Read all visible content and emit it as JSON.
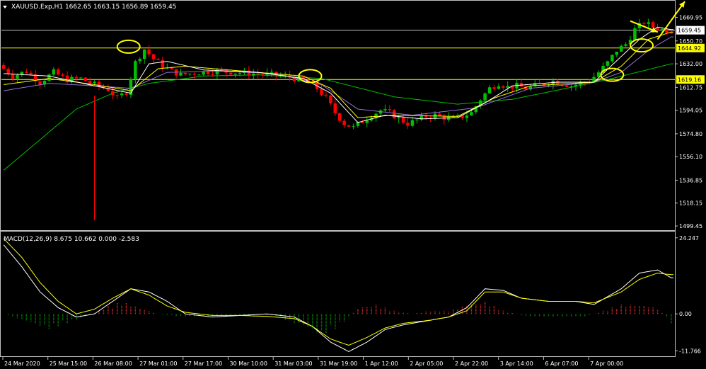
{
  "chart_data": {
    "type": "candlestick",
    "symbol": "XAUUSD.Exp",
    "timeframe": "H1",
    "ohlc_label": {
      "open": "1662.65",
      "high": "1663.15",
      "low": "1656.89",
      "close": "1659.45"
    },
    "header_text": "XAUUSD.Exp,H1  1662.65 1663.15 1656.89 1659.45",
    "price_axis": {
      "ylim": [
        1496,
        1683
      ],
      "ticks": [
        "1669.95",
        "1650.70",
        "1632.00",
        "1612.75",
        "1594.05",
        "1574.80",
        "1556.10",
        "1536.85",
        "1518.15",
        "1499.45"
      ],
      "tick_values": [
        1669.95,
        1650.7,
        1632.0,
        1612.75,
        1594.05,
        1574.8,
        1556.1,
        1536.85,
        1518.15,
        1499.45
      ]
    },
    "price_labels": [
      {
        "text": "1659.45",
        "value": 1659.45,
        "bg": "#ffffff",
        "fg": "#000000"
      },
      {
        "text": "1644.92",
        "value": 1644.92,
        "bg": "#ffff00",
        "fg": "#000000"
      },
      {
        "text": "1619.16",
        "value": 1619.16,
        "bg": "#ffff00",
        "fg": "#000000"
      }
    ],
    "horizontal_lines": [
      {
        "value": 1659.45,
        "color": "#c0c0c0"
      },
      {
        "value": 1644.92,
        "color": "#ffff00"
      },
      {
        "value": 1619.16,
        "color": "#ffff00"
      }
    ],
    "time_axis": {
      "labels": [
        "24 Mar 2020",
        "25 Mar 15:00",
        "26 Mar 08:00",
        "27 Mar 01:00",
        "27 Mar 17:00",
        "30 Mar 10:00",
        "31 Mar 03:00",
        "31 Mar 19:00",
        "1 Apr 12:00",
        "2 Apr 05:00",
        "2 Apr 22:00",
        "3 Apr 14:00",
        "6 Apr 07:00",
        "7 Apr 00:00"
      ]
    },
    "price_path": [
      [
        0,
        1631
      ],
      [
        3,
        1622
      ],
      [
        6,
        1626
      ],
      [
        9,
        1617
      ],
      [
        12,
        1625
      ],
      [
        15,
        1619
      ],
      [
        18,
        1620
      ],
      [
        21,
        1615
      ],
      [
        24,
        1611
      ],
      [
        26,
        1604
      ],
      [
        28,
        1609
      ],
      [
        30,
        1633
      ],
      [
        32,
        1644
      ],
      [
        34,
        1636
      ],
      [
        36,
        1630
      ],
      [
        38,
        1626
      ],
      [
        40,
        1623
      ],
      [
        44,
        1625
      ],
      [
        48,
        1626
      ],
      [
        52,
        1625
      ],
      [
        56,
        1624
      ],
      [
        60,
        1623
      ],
      [
        64,
        1621
      ],
      [
        66,
        1619
      ],
      [
        68,
        1617
      ],
      [
        70,
        1612
      ],
      [
        72,
        1604
      ],
      [
        74,
        1592
      ],
      [
        76,
        1583
      ],
      [
        78,
        1580
      ],
      [
        80,
        1585
      ],
      [
        82,
        1590
      ],
      [
        84,
        1594
      ],
      [
        86,
        1592
      ],
      [
        88,
        1587
      ],
      [
        90,
        1583
      ],
      [
        92,
        1586
      ],
      [
        94,
        1589
      ],
      [
        96,
        1590
      ],
      [
        98,
        1588
      ],
      [
        100,
        1587
      ],
      [
        102,
        1589
      ],
      [
        104,
        1592
      ],
      [
        106,
        1603
      ],
      [
        108,
        1612
      ],
      [
        110,
        1616
      ],
      [
        112,
        1613
      ],
      [
        114,
        1614
      ],
      [
        116,
        1612
      ],
      [
        118,
        1614
      ],
      [
        120,
        1616
      ],
      [
        122,
        1618
      ],
      [
        124,
        1616
      ],
      [
        126,
        1614
      ],
      [
        128,
        1616
      ],
      [
        130,
        1618
      ],
      [
        132,
        1625
      ],
      [
        134,
        1633
      ],
      [
        136,
        1643
      ],
      [
        138,
        1648
      ],
      [
        140,
        1660
      ],
      [
        142,
        1666
      ],
      [
        144,
        1662
      ],
      [
        146,
        1660
      ],
      [
        147,
        1659.45
      ]
    ],
    "ma_fast": [
      [
        0,
        1624
      ],
      [
        10,
        1622
      ],
      [
        20,
        1614
      ],
      [
        28,
        1608
      ],
      [
        32,
        1632
      ],
      [
        36,
        1634
      ],
      [
        44,
        1627
      ],
      [
        56,
        1625
      ],
      [
        66,
        1620
      ],
      [
        72,
        1608
      ],
      [
        78,
        1584
      ],
      [
        84,
        1590
      ],
      [
        92,
        1587
      ],
      [
        100,
        1588
      ],
      [
        106,
        1600
      ],
      [
        112,
        1614
      ],
      [
        122,
        1617
      ],
      [
        130,
        1617
      ],
      [
        136,
        1638
      ],
      [
        140,
        1652
      ],
      [
        144,
        1662
      ],
      [
        147,
        1660
      ]
    ],
    "ma_mid": [
      [
        0,
        1615
      ],
      [
        10,
        1620
      ],
      [
        20,
        1615
      ],
      [
        28,
        1610
      ],
      [
        34,
        1628
      ],
      [
        40,
        1630
      ],
      [
        56,
        1625
      ],
      [
        66,
        1622
      ],
      [
        72,
        1612
      ],
      [
        78,
        1588
      ],
      [
        86,
        1590
      ],
      [
        100,
        1589
      ],
      [
        108,
        1604
      ],
      [
        116,
        1614
      ],
      [
        130,
        1617
      ],
      [
        136,
        1630
      ],
      [
        142,
        1652
      ],
      [
        147,
        1658
      ]
    ],
    "ma_slow": [
      [
        0,
        1610
      ],
      [
        10,
        1616
      ],
      [
        20,
        1614
      ],
      [
        28,
        1612
      ],
      [
        36,
        1625
      ],
      [
        48,
        1626
      ],
      [
        60,
        1624
      ],
      [
        70,
        1615
      ],
      [
        78,
        1595
      ],
      [
        90,
        1590
      ],
      [
        104,
        1596
      ],
      [
        116,
        1612
      ],
      [
        130,
        1617
      ],
      [
        136,
        1625
      ],
      [
        142,
        1643
      ],
      [
        147,
        1654
      ]
    ],
    "ma_long": [
      [
        0,
        1545
      ],
      [
        8,
        1570
      ],
      [
        16,
        1595
      ],
      [
        24,
        1608
      ],
      [
        32,
        1616
      ],
      [
        44,
        1622
      ],
      [
        56,
        1623
      ],
      [
        70,
        1620
      ],
      [
        86,
        1605
      ],
      [
        100,
        1599
      ],
      [
        112,
        1603
      ],
      [
        124,
        1612
      ],
      [
        134,
        1620
      ],
      [
        147,
        1632
      ]
    ],
    "spike": {
      "index": 20,
      "low": 1504
    },
    "markers": {
      "ellipses": [
        {
          "index": 27.5,
          "value": 1646
        },
        {
          "index": 67.5,
          "value": 1622
        },
        {
          "index": 134,
          "value": 1623
        },
        {
          "index": 140.5,
          "value": 1647
        }
      ],
      "arrows": [
        {
          "from": [
            138,
            1667
          ],
          "to": [
            144,
            1658
          ]
        },
        {
          "from": [
            144,
            1652
          ],
          "to": [
            150,
            1683
          ]
        }
      ]
    },
    "macd": {
      "label": "MACD(12,26,9) 8.675 10.662 0.000 -2.583",
      "ylim": [
        -13.5,
        26
      ],
      "ticks": [
        "24.247",
        "0.00",
        "-11.766"
      ],
      "tick_values": [
        24.247,
        0.0,
        -11.766
      ],
      "macd_line": [
        [
          0,
          22
        ],
        [
          4,
          15
        ],
        [
          8,
          7
        ],
        [
          12,
          2
        ],
        [
          16,
          -1
        ],
        [
          20,
          0
        ],
        [
          24,
          4
        ],
        [
          28,
          8
        ],
        [
          32,
          7
        ],
        [
          36,
          4
        ],
        [
          40,
          0
        ],
        [
          46,
          -1
        ],
        [
          52,
          -0.5
        ],
        [
          58,
          0
        ],
        [
          64,
          -1
        ],
        [
          68,
          -4
        ],
        [
          72,
          -9
        ],
        [
          76,
          -12
        ],
        [
          80,
          -9
        ],
        [
          84,
          -5
        ],
        [
          88,
          -3.5
        ],
        [
          94,
          -2
        ],
        [
          98,
          -1
        ],
        [
          102,
          2
        ],
        [
          106,
          8
        ],
        [
          110,
          7.5
        ],
        [
          114,
          5
        ],
        [
          120,
          4
        ],
        [
          126,
          4
        ],
        [
          130,
          3
        ],
        [
          136,
          8
        ],
        [
          140,
          13
        ],
        [
          144,
          14
        ],
        [
          147,
          11.5
        ]
      ],
      "signal_line": [
        [
          0,
          24
        ],
        [
          4,
          18
        ],
        [
          8,
          10
        ],
        [
          12,
          4
        ],
        [
          16,
          0
        ],
        [
          20,
          1.5
        ],
        [
          24,
          5
        ],
        [
          28,
          8
        ],
        [
          32,
          6
        ],
        [
          36,
          2.5
        ],
        [
          40,
          0.5
        ],
        [
          46,
          -0.5
        ],
        [
          52,
          -0.5
        ],
        [
          58,
          -0.8
        ],
        [
          64,
          -1.5
        ],
        [
          68,
          -4
        ],
        [
          72,
          -8
        ],
        [
          76,
          -10
        ],
        [
          80,
          -7.5
        ],
        [
          84,
          -4.5
        ],
        [
          88,
          -3
        ],
        [
          94,
          -2
        ],
        [
          98,
          -1
        ],
        [
          102,
          1
        ],
        [
          106,
          7
        ],
        [
          110,
          7
        ],
        [
          114,
          5
        ],
        [
          120,
          4
        ],
        [
          126,
          4
        ],
        [
          130,
          3.5
        ],
        [
          136,
          7
        ],
        [
          140,
          11
        ],
        [
          144,
          13
        ],
        [
          147,
          12.5
        ]
      ],
      "histogram_shape": [
        [
          0,
          0
        ],
        [
          10,
          -5
        ],
        [
          14,
          -3
        ],
        [
          18,
          -1
        ],
        [
          22,
          2
        ],
        [
          26,
          4
        ],
        [
          30,
          2
        ],
        [
          34,
          0
        ],
        [
          40,
          -1
        ],
        [
          48,
          -1
        ],
        [
          56,
          0
        ],
        [
          60,
          -1
        ],
        [
          66,
          -4
        ],
        [
          70,
          -7
        ],
        [
          74,
          -4
        ],
        [
          78,
          2
        ],
        [
          82,
          3
        ],
        [
          86,
          1
        ],
        [
          90,
          0
        ],
        [
          94,
          1
        ],
        [
          98,
          1
        ],
        [
          102,
          3
        ],
        [
          106,
          4
        ],
        [
          110,
          1
        ],
        [
          116,
          -1
        ],
        [
          122,
          -1
        ],
        [
          128,
          -1
        ],
        [
          132,
          1
        ],
        [
          136,
          3
        ],
        [
          140,
          3
        ],
        [
          144,
          2
        ],
        [
          147,
          -3
        ]
      ]
    }
  },
  "colors": {
    "bg": "#000000",
    "bull": "#00c000",
    "bear": "#ff0000",
    "wick": "#00c000",
    "ma_fast": "#ffffff",
    "ma_mid": "#ffff00",
    "ma_slow": "#9370db",
    "ma_long": "#00c000",
    "grid": "#c0c0c0",
    "macd_line": "#ffffff",
    "signal_line": "#ffff00",
    "hist_pos": "#ff3030",
    "hist_neg": "#00a000",
    "marker": "#ffff00"
  }
}
